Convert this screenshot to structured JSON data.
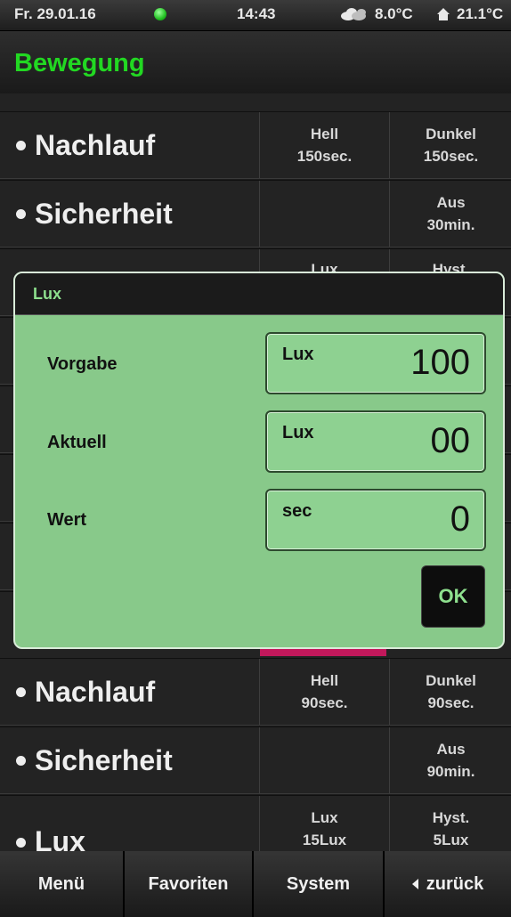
{
  "status": {
    "date": "Fr. 29.01.16",
    "time": "14:43",
    "outdoor_temp": "8.0°C",
    "indoor_temp": "21.1°C",
    "status_dot_color": "#22c022"
  },
  "header": {
    "title": "Bewegung"
  },
  "rows_top": [
    {
      "label": "Nachlauf",
      "a_top": "Hell",
      "a_bottom": "150sec.",
      "b_top": "Dunkel",
      "b_bottom": "150sec."
    },
    {
      "label": "Sicherheit",
      "a_top": "",
      "a_bottom": "",
      "b_top": "Aus",
      "b_bottom": "30min."
    },
    {
      "label": "",
      "a_top": "Lux",
      "a_bottom": "",
      "b_top": "Hyst.",
      "b_bottom": ""
    }
  ],
  "rows_bottom": [
    {
      "label": "Nachlauf",
      "a_top": "Hell",
      "a_bottom": "90sec.",
      "b_top": "Dunkel",
      "b_bottom": "90sec."
    },
    {
      "label": "Sicherheit",
      "a_top": "",
      "a_bottom": "",
      "b_top": "Aus",
      "b_bottom": "90min."
    },
    {
      "label": "Lux",
      "a_top": "Lux",
      "a_bottom": "15Lux",
      "b_top": "Hyst.",
      "b_bottom": "5Lux"
    }
  ],
  "dialog": {
    "title": "Lux",
    "fields": [
      {
        "label": "Vorgabe",
        "unit": "Lux",
        "value": "100"
      },
      {
        "label": "Aktuell",
        "unit": "Lux",
        "value": "00"
      },
      {
        "label": "Wert",
        "unit": "sec",
        "value": "0"
      }
    ],
    "ok_label": "OK"
  },
  "nav": {
    "menu": "Menü",
    "favorites": "Favoriten",
    "system": "System",
    "back": "zurück"
  },
  "colors": {
    "accent_green": "#22d822",
    "dialog_bg": "#88c98a",
    "highlight_pink": "#c2185b"
  }
}
